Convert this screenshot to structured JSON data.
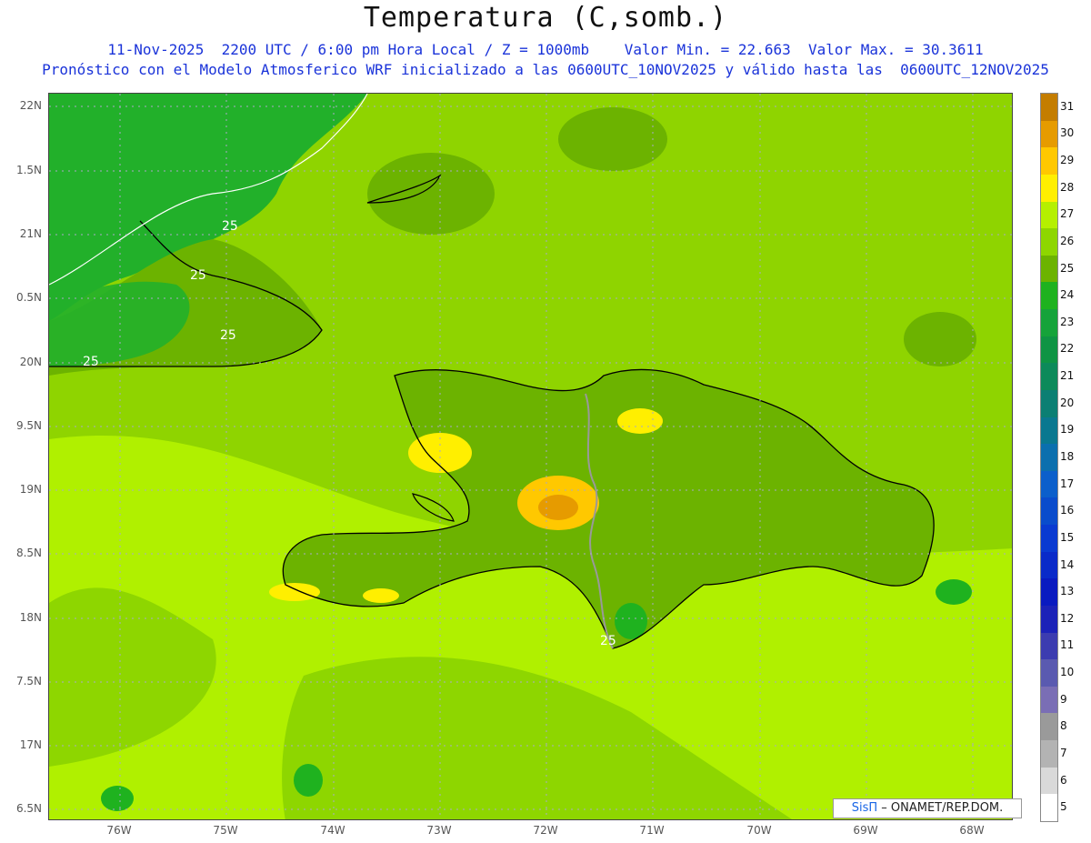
{
  "header": {
    "title": "Temperatura (C,somb.)",
    "line1": "11-Nov-2025  2200 UTC / 6:00 pm Hora Local / Z = 1000mb    Valor Min. = 22.663  Valor Max. = 30.3611",
    "line2": "Pronóstico con el Modelo Atmosferico WRF inicializado a las 0600UTC_10NOV2025 y válido hasta las  0600UTC_12NOV2025"
  },
  "axes": {
    "lat_labels": [
      "22N",
      "1.5N",
      "21N",
      "0.5N",
      "20N",
      "9.5N",
      "19N",
      "8.5N",
      "18N",
      "7.5N",
      "17N",
      "6.5N"
    ],
    "lon_labels": [
      "76W",
      "75W",
      "74W",
      "73W",
      "72W",
      "71W",
      "70W",
      "69W",
      "68W"
    ]
  },
  "contour_label": "25",
  "colorbar": {
    "labels": [
      "31",
      "30",
      "29",
      "28",
      "27",
      "26",
      "25",
      "24",
      "23",
      "22",
      "21",
      "20",
      "19",
      "18",
      "17",
      "16",
      "15",
      "14",
      "13",
      "12",
      "11",
      "10",
      "9",
      "8",
      "7",
      "6",
      "5"
    ],
    "colors": [
      "#c47d00",
      "#e69b00",
      "#ffc800",
      "#ffef00",
      "#b5f000",
      "#8ed600",
      "#6cb300",
      "#1fb21f",
      "#16a33a",
      "#0f9444",
      "#0d8a5a",
      "#0b7f73",
      "#0a7890",
      "#0b6fae",
      "#0b5fcb",
      "#0a4ccc",
      "#0a3ad1",
      "#0a2ac9",
      "#0a1ac0",
      "#1c22b8",
      "#3c3cb0",
      "#5a5ab0",
      "#7a6eb5",
      "#9a9a9a",
      "#b3b3b3",
      "#d9d9d9",
      "#ffffff"
    ]
  },
  "credit": {
    "brand": "SisΠ",
    "text": " – ONAMET/REP.DOM."
  }
}
